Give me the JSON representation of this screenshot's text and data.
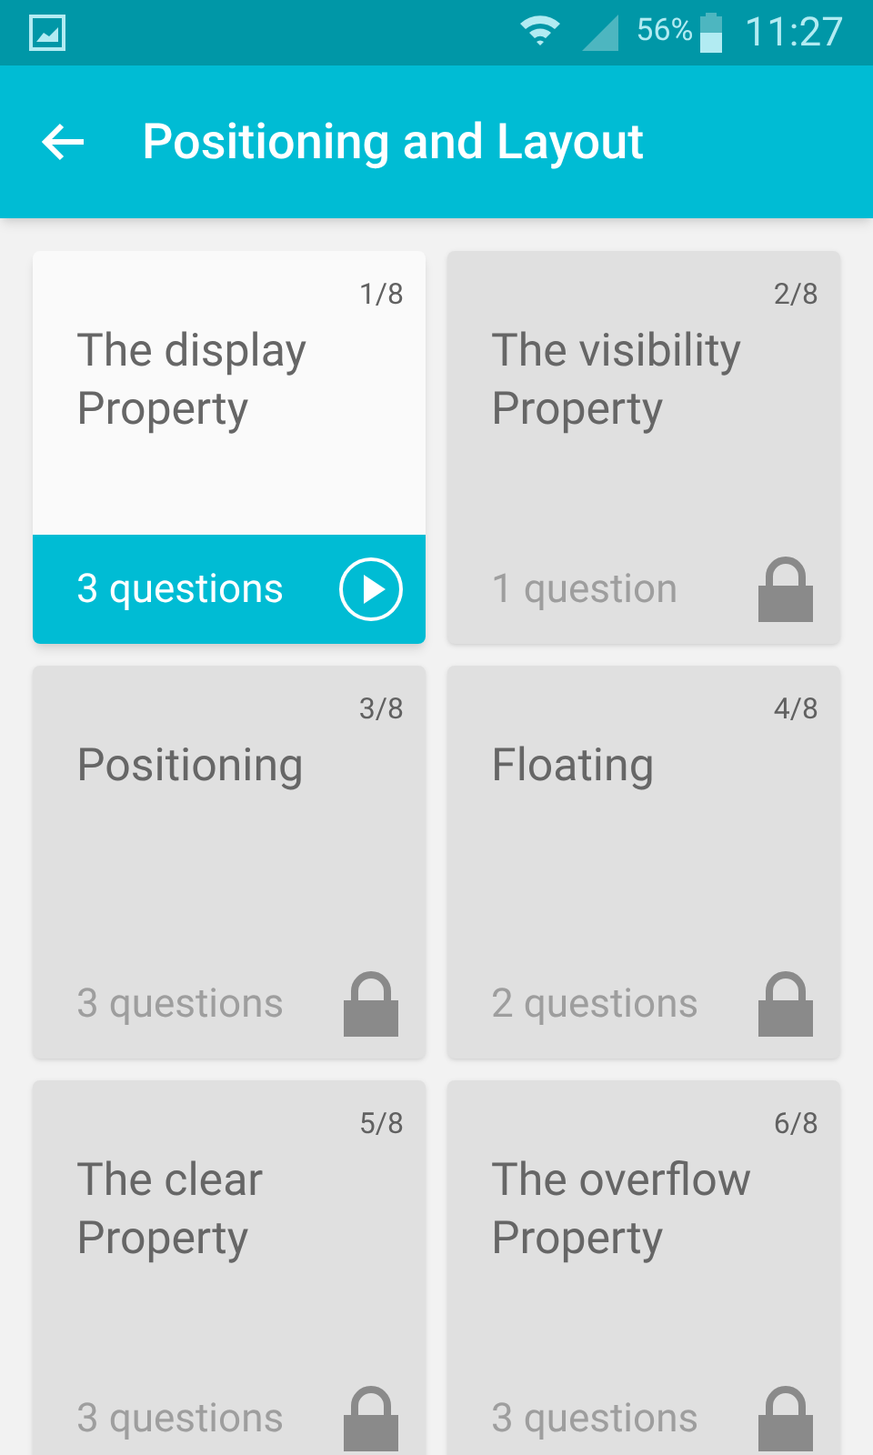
{
  "status_bar": {
    "battery": "56%",
    "time": "11:27"
  },
  "app_bar": {
    "title": "Positioning and Layout"
  },
  "lessons": [
    {
      "counter": "1/8",
      "title": "The display Property",
      "questions": "3 questions",
      "locked": false
    },
    {
      "counter": "2/8",
      "title": "The visibility Property",
      "questions": "1 question",
      "locked": true
    },
    {
      "counter": "3/8",
      "title": "Positioning",
      "questions": "3 questions",
      "locked": true
    },
    {
      "counter": "4/8",
      "title": "Floating",
      "questions": "2 questions",
      "locked": true
    },
    {
      "counter": "5/8",
      "title": "The clear Property",
      "questions": "3 questions",
      "locked": true
    },
    {
      "counter": "6/8",
      "title": "The overflow Property",
      "questions": "3 questions",
      "locked": true
    }
  ]
}
